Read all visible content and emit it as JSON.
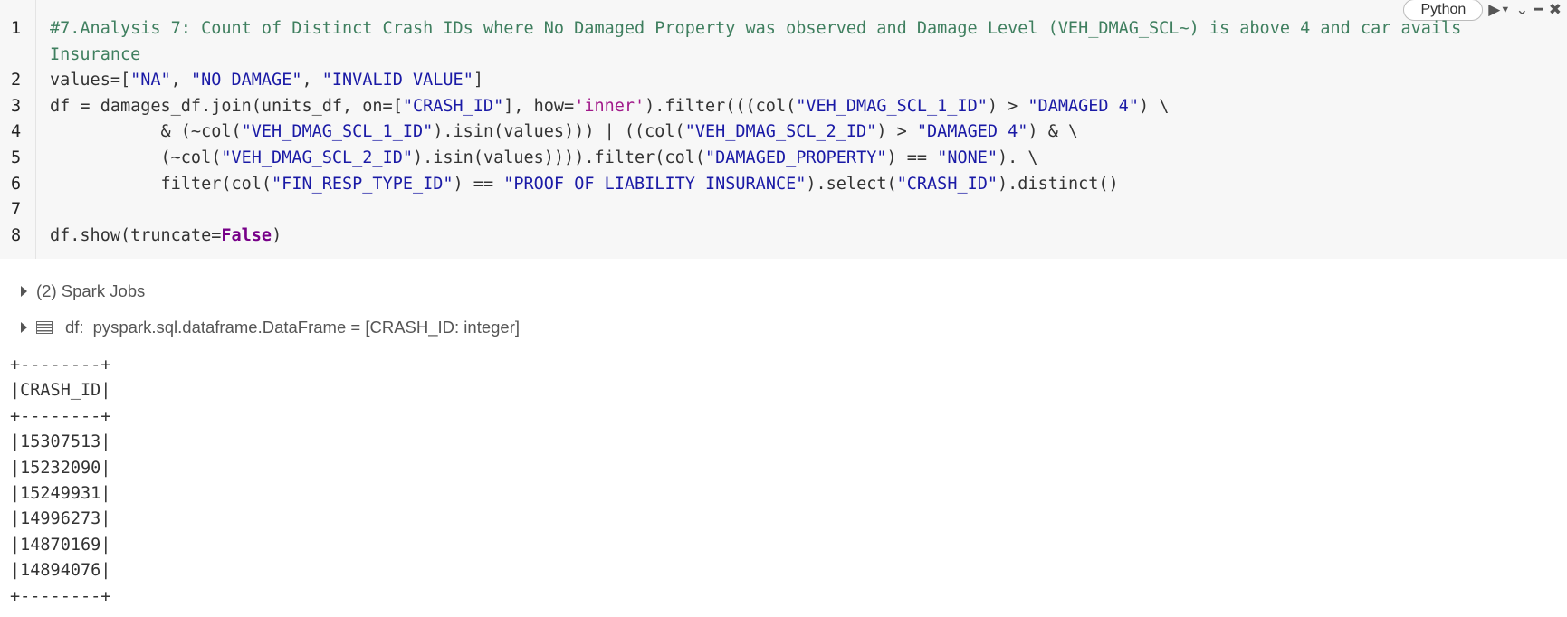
{
  "toolbar": {
    "language_label": "Python",
    "run_icon": "play-icon",
    "run_dropdown_icon": "chevron-down-icon",
    "collapse_icon": "chevron-down-icon",
    "minimize_icon": "minus-icon",
    "close_icon": "close-icon"
  },
  "code": {
    "line_numbers": [
      "1",
      "",
      "2",
      "3",
      "4",
      "5",
      "6",
      "7",
      "8"
    ],
    "line1a": "#7.Analysis 7: Count of Distinct Crash IDs where No Damaged Property was observed and Damage Level (VEH_DMAG_SCL~) is above 4 and car avails",
    "line1b": "Insurance",
    "l2": {
      "p1": "values=[",
      "s1": "\"NA\"",
      "p2": ", ",
      "s2": "\"NO DAMAGE\"",
      "p3": ", ",
      "s3": "\"INVALID VALUE\"",
      "p4": "]"
    },
    "l3": {
      "p1": "df = damages_df.join(units_df, on=[",
      "s1": "\"CRASH_ID\"",
      "p2": "], how=",
      "s2": "'inner'",
      "p3": ").filter(((col(",
      "s3": "\"VEH_DMAG_SCL_1_ID\"",
      "p4": ") > ",
      "s4": "\"DAMAGED 4\"",
      "p5": ") \\"
    },
    "l4": {
      "p1": "           & (~col(",
      "s1": "\"VEH_DMAG_SCL_1_ID\"",
      "p2": ").isin(values))) | ((col(",
      "s2": "\"VEH_DMAG_SCL_2_ID\"",
      "p3": ") > ",
      "s3": "\"DAMAGED 4\"",
      "p4": ") & \\"
    },
    "l5": {
      "p1": "           (~col(",
      "s1": "\"VEH_DMAG_SCL_2_ID\"",
      "p2": ").isin(values)))).filter(col(",
      "s2": "\"DAMAGED_PROPERTY\"",
      "p3": ") == ",
      "s3": "\"NONE\"",
      "p4": "). \\"
    },
    "l6": {
      "p1": "           filter(col(",
      "s1": "\"FIN_RESP_TYPE_ID\"",
      "p2": ") == ",
      "s2": "\"PROOF OF LIABILITY INSURANCE\"",
      "p3": ").select(",
      "s3": "\"CRASH_ID\"",
      "p4": ").distinct()"
    },
    "l8": {
      "p1": "df.show(truncate=",
      "kw": "False",
      "p2": ")"
    }
  },
  "output": {
    "spark_jobs_label": "(2) Spark Jobs",
    "df_name": "df:",
    "df_schema": "pyspark.sql.dataframe.DataFrame = [CRASH_ID: integer]",
    "table_border": "+--------+",
    "table_header": "|CRASH_ID|",
    "rows": [
      "|15307513|",
      "|15232090|",
      "|15249931|",
      "|14996273|",
      "|14870169|",
      "|14894076|"
    ]
  }
}
